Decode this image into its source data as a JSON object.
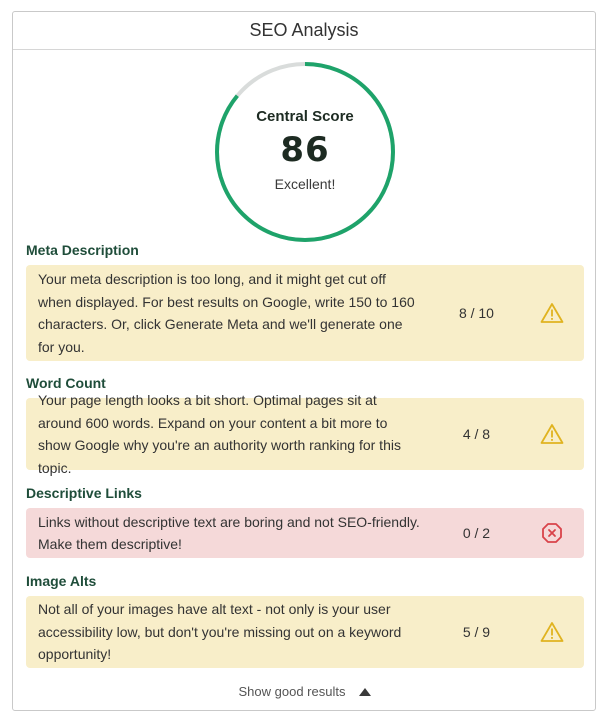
{
  "panel": {
    "title": "SEO Analysis"
  },
  "score": {
    "title": "Central Score",
    "value": "86",
    "value_fraction": 0.86,
    "grade": "Excellent!",
    "ring_color": "#1ea36a",
    "track_color": "#d9dcdb"
  },
  "sections": [
    {
      "title": "Meta Description",
      "text": "Your meta description is too long, and it might get cut off when displayed. For best results on Google, write 150 to 160 characters. Or, click Generate Meta and we'll generate one for you.",
      "score": "8 / 10",
      "status": "warning",
      "icon": "warning-icon"
    },
    {
      "title": "Word Count",
      "text": "Your page length looks a bit short. Optimal pages sit at around 600 words. Expand on your content a bit more to show Google why you're an authority worth ranking for this topic.",
      "score": "4 / 8",
      "status": "warning",
      "icon": "warning-icon"
    },
    {
      "title": "Descriptive Links",
      "text": "Links without descriptive text are boring and not SEO-friendly. Make them descriptive!",
      "score": "0 / 2",
      "status": "error",
      "icon": "error-icon"
    },
    {
      "title": "Image Alts",
      "text": "Not all of your images have alt text - not only is your user accessibility low, but don't you're missing out on a keyword opportunity!",
      "score": "5 / 9",
      "status": "warning",
      "icon": "warning-icon"
    }
  ],
  "footer": {
    "toggle_label": "Show good results",
    "toggle_icon": "caret-up-icon"
  },
  "colors": {
    "warning_bg": "#f8eec9",
    "error_bg": "#f5d9d9",
    "warning_icon": "#e0b320",
    "error_icon": "#d9434a",
    "section_title": "#1f4d3a"
  }
}
